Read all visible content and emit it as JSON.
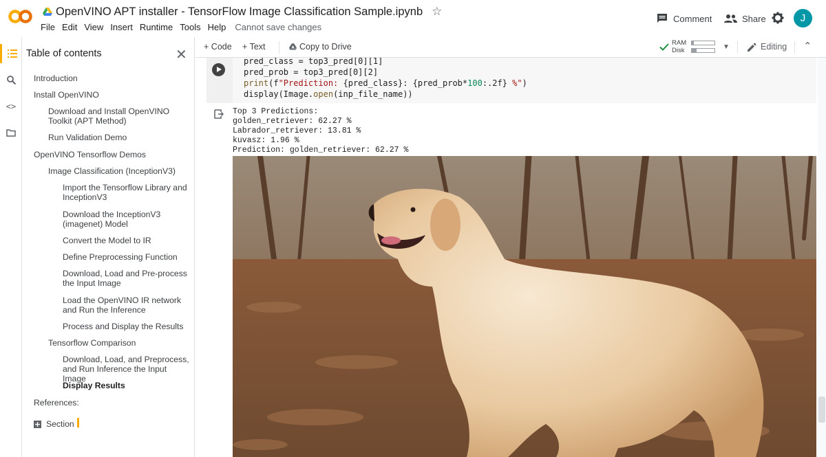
{
  "header": {
    "title": "OpenVINO APT installer - TensorFlow Image Classification Sample.ipynb",
    "menu": [
      "File",
      "Edit",
      "View",
      "Insert",
      "Runtime",
      "Tools",
      "Help"
    ],
    "save_status": "Cannot save changes",
    "comment_label": "Comment",
    "share_label": "Share",
    "avatar_letter": "J"
  },
  "toc": {
    "title": "Table of contents",
    "items": [
      {
        "label": "Introduction",
        "level": 1
      },
      {
        "label": "Install OpenVINO",
        "level": 1
      },
      {
        "label": "Download and Install OpenVINO Toolkit (APT Method)",
        "level": 2
      },
      {
        "label": "Run Validation Demo",
        "level": 2
      },
      {
        "label": "OpenVINO Tensorflow Demos",
        "level": 1
      },
      {
        "label": "Image Classification (InceptionV3)",
        "level": 2
      },
      {
        "label": "Import the Tensorflow Library and InceptionV3",
        "level": 3
      },
      {
        "label": "Download the InceptionV3 (imagenet) Model",
        "level": 3
      },
      {
        "label": "Convert the Model to IR",
        "level": 3
      },
      {
        "label": "Define Preprocessing Function",
        "level": 3
      },
      {
        "label": "Download, Load and Pre-process the Input Image",
        "level": 3
      },
      {
        "label": "Load the OpenVINO IR network and Run the Inference",
        "level": 3
      },
      {
        "label": "Process and Display the Results",
        "level": 3
      },
      {
        "label": "Tensorflow Comparison",
        "level": 2
      },
      {
        "label": "Download, Load, and Preprocess, and Run Inference the Input Image",
        "level": 3
      },
      {
        "label": "Display Results",
        "level": 3,
        "active": true
      },
      {
        "label": "References:",
        "level": 1
      },
      {
        "label": "Section",
        "level": 1
      }
    ]
  },
  "toolbar": {
    "code_label": "Code",
    "text_label": "Text",
    "copy_label": "Copy to Drive",
    "ram_label": "RAM",
    "disk_label": "Disk",
    "ram_usage": 0.08,
    "disk_usage": 0.22,
    "editing_label": "Editing"
  },
  "cell": {
    "code_lines": [
      "pred_class = top3_pred[0][1]",
      "pred_prob = top3_pred[0][2]",
      "print(f\"Prediction: {pred_class}: {pred_prob*100:.2f} %\")",
      "display(Image.open(inp_file_name))"
    ],
    "output_lines": [
      "Top 3 Predictions:",
      "golden_retriever: 62.27 %",
      "Labrador_retriever: 13.81 %",
      "kuvasz: 1.96 %",
      "Prediction: golden_retriever: 62.27 %"
    ]
  },
  "colors": {
    "accent": "#f9ab00",
    "avatar": "#0097a7",
    "ok": "#1e8e3e"
  }
}
